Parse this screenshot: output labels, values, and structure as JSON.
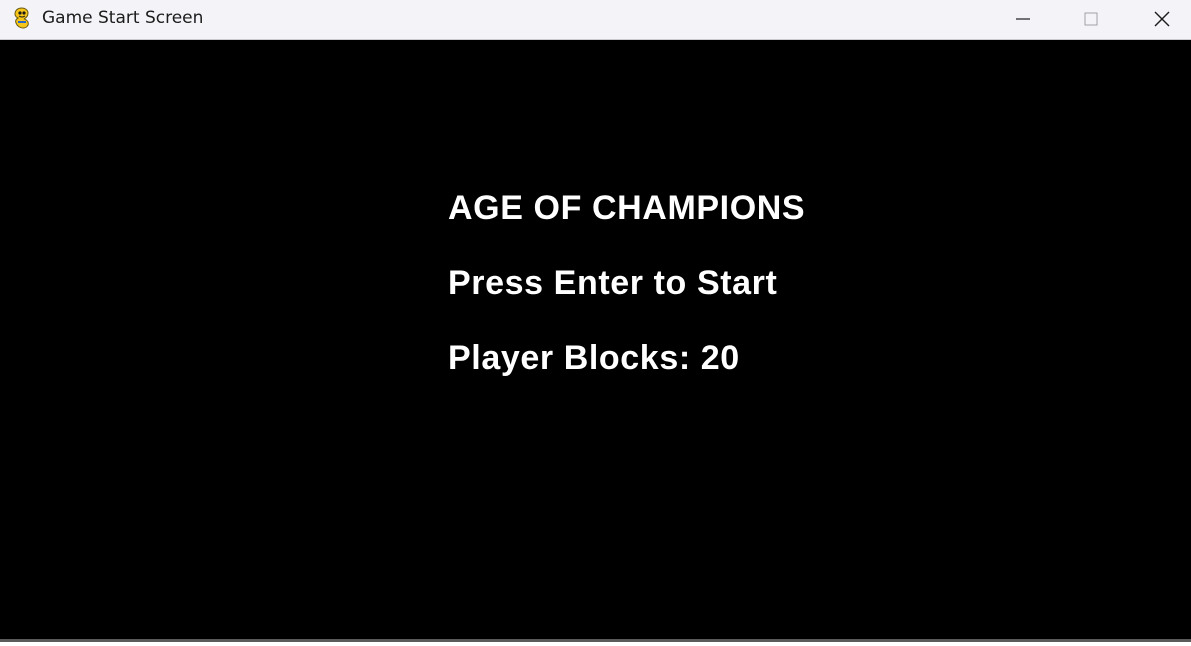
{
  "window": {
    "title": "Game Start Screen",
    "app_icon": "pygame-snake-icon",
    "controls": {
      "minimize_icon": "minimize-icon",
      "maximize_icon": "maximize-icon",
      "close_icon": "close-icon"
    }
  },
  "game": {
    "title": "AGE OF CHAMPIONS",
    "prompt": "Press Enter to Start",
    "player_blocks": "Player Blocks: 20"
  },
  "colors": {
    "background": "#000000",
    "text": "#ffffff",
    "titlebar": "#f3f3f8"
  }
}
